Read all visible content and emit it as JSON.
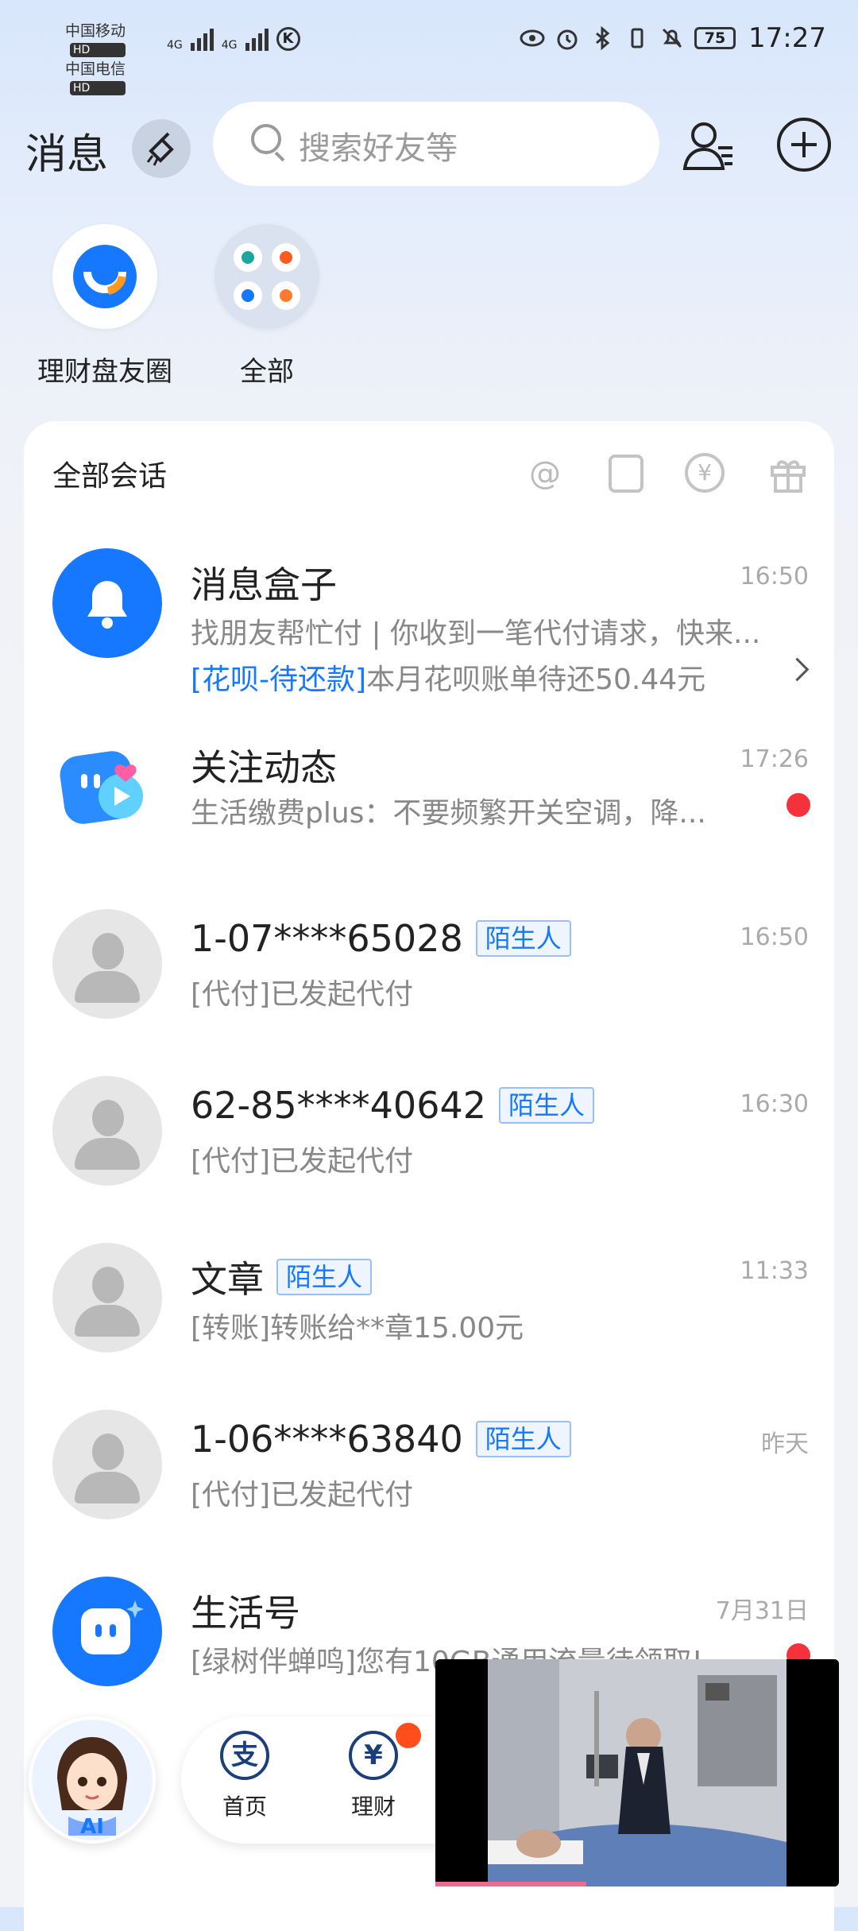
{
  "status": {
    "carrier1": "中国移动",
    "carrier2": "中国电信",
    "hd": "HD",
    "net1": "4G",
    "net2": "4G",
    "k": "K",
    "battery": "75",
    "time": "17:27"
  },
  "header": {
    "title": "消息",
    "search_placeholder": "搜索好友等"
  },
  "shortcuts": [
    {
      "label": "理财盘友圈"
    },
    {
      "label": "全部"
    }
  ],
  "card": {
    "title": "全部会话",
    "filters": [
      "@",
      "¥"
    ]
  },
  "conversations": [
    {
      "name": "消息盒子",
      "preview": "找朋友帮忙付 | 你收到一笔代付请求，快来...",
      "time": "16:50",
      "extra_tag": "[花呗-待还款]",
      "extra_text": "本月花呗账单待还50.44元"
    },
    {
      "name": "关注动态",
      "preview": "生活缴费plus：不要频繁开关空调，降...",
      "time": "17:26"
    },
    {
      "name": "1-07****65028",
      "badge": "陌生人",
      "preview": "[代付]已发起代付",
      "time": "16:50"
    },
    {
      "name": "62-85****40642",
      "badge": "陌生人",
      "preview": "[代付]已发起代付",
      "time": "16:30"
    },
    {
      "name": "文章",
      "badge": "陌生人",
      "preview": "[转账]转账给**章15.00元",
      "time": "11:33"
    },
    {
      "name": "1-06****63840",
      "badge": "陌生人",
      "preview": "[代付]已发起代付",
      "time": "昨天"
    },
    {
      "name": "生活号",
      "preview": "[绿树伴蝉鸣]您有10GB通用流量待领取!",
      "time": "7月31日"
    }
  ],
  "bottom": {
    "ai_label": "AI",
    "tabs": [
      {
        "label": "首页",
        "icon_char": "支"
      },
      {
        "label": "理财",
        "icon_char": "¥"
      }
    ]
  },
  "colors": {
    "accent": "#1677ff",
    "unread": "#f5323c"
  }
}
